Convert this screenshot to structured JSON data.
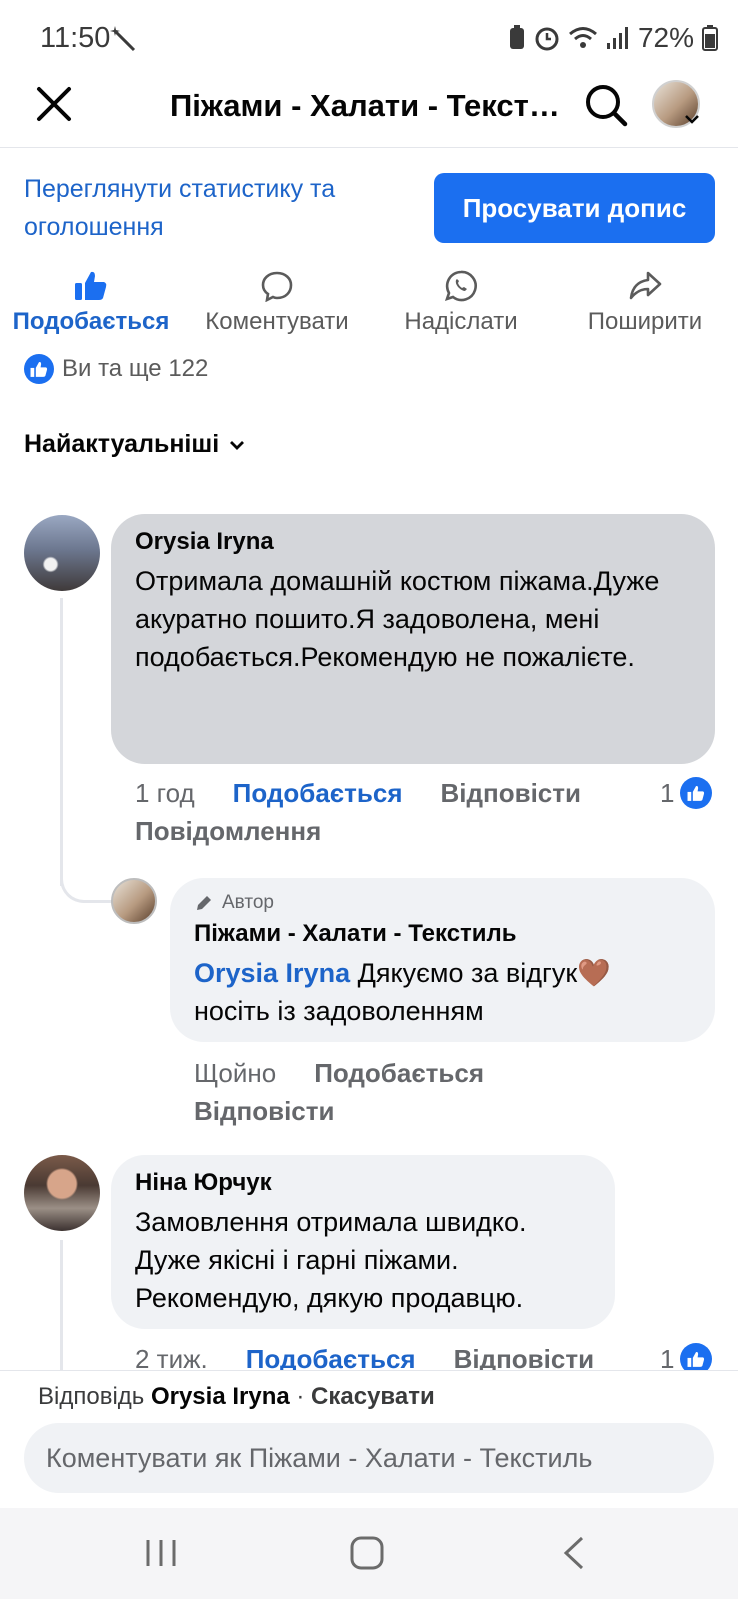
{
  "status_bar": {
    "time": "11:50",
    "battery": "72%"
  },
  "header": {
    "title": "Піжами - Халати - Текстиль"
  },
  "stats_link": "Переглянути статистику та оголошення",
  "promote_button": "Просувати допис",
  "actions": {
    "like": "Подобається",
    "comment": "Коментувати",
    "send": "Надіслати",
    "share": "Поширити"
  },
  "reactions_text": "Ви та ще 122",
  "sort_label": "Найактуальніші",
  "comments": [
    {
      "author": "Orysia Iryna",
      "text": "Отримала домашній костюм піжама.Дуже акуратно пошито.Я задоволена, мені подобається.Рекомендую не пожалієте.",
      "time": "1 год",
      "like": "Подобається",
      "reply": "Відповісти",
      "message": "Повідомлення",
      "like_count": "1"
    },
    {
      "badge": "Автор",
      "author": "Піжами - Халати - Текстиль",
      "mention": "Orysia Iryna",
      "text_after_mention": " Дякуємо за відгук🤎 носіть із задоволенням",
      "time": "Щойно",
      "like": "Подобається",
      "reply": "Відповісти"
    },
    {
      "author": "Ніна Юрчук",
      "text": "Замовлення отримала швидко. Дуже якісні і гарні піжами. Рекомендую, дякую продавцю.",
      "time": "2 тиж.",
      "like": "Подобається",
      "reply": "Відповісти",
      "like_count": "1"
    }
  ],
  "composer": {
    "reply_prefix": "Відповідь",
    "reply_name": "Orysia Iryna",
    "separator": "·",
    "cancel": "Скасувати",
    "placeholder": "Коментувати як Піжами - Халати - Текстиль"
  },
  "colors": {
    "accent": "#1b6ff0",
    "link": "#1d64c9",
    "bubble_selected": "#d4d6da",
    "bubble": "#f0f2f5"
  }
}
